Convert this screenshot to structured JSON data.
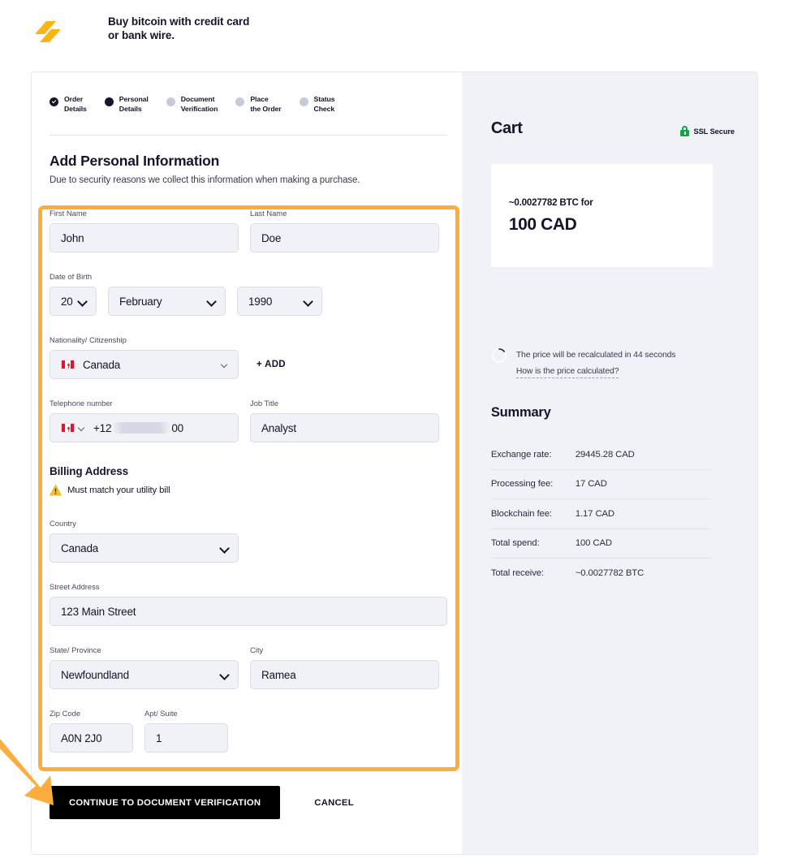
{
  "header": {
    "logo_icon": "lightning-bolt-logo",
    "tagline": "Buy bitcoin with credit card or bank wire."
  },
  "stepper": {
    "steps": [
      {
        "label": "Order\nDetails",
        "state": "done"
      },
      {
        "label": "Personal\nDetails",
        "state": "active"
      },
      {
        "label": "Document\nVerification",
        "state": "pending"
      },
      {
        "label": "Place\nthe Order",
        "state": "pending"
      },
      {
        "label": "Status\nCheck",
        "state": "pending"
      }
    ]
  },
  "form": {
    "title": "Add Personal Information",
    "subtitle": "Due to security reasons we collect this information when making a purchase.",
    "first_name": {
      "label": "First Name",
      "value": "John"
    },
    "last_name": {
      "label": "Last Name",
      "value": "Doe"
    },
    "dob": {
      "label": "Date of Birth",
      "day": "20",
      "month": "February",
      "year": "1990"
    },
    "nationality": {
      "label": "Nationality/ Citizenship",
      "value": "Canada",
      "flag_icon": "canada-flag-icon",
      "add_label": "+ ADD"
    },
    "telephone": {
      "label": "Telephone number",
      "flag_icon": "canada-flag-icon",
      "prefix": "+12",
      "suffix": "00"
    },
    "job_title": {
      "label": "Job Title",
      "value": "Analyst"
    },
    "billing": {
      "heading": "Billing Address",
      "warning_icon": "warning-triangle-icon",
      "warning": "Must match your utility bill"
    },
    "country": {
      "label": "Country",
      "value": "Canada"
    },
    "street": {
      "label": "Street Address",
      "value": "123 Main Street"
    },
    "state": {
      "label": "State/ Province",
      "value": "Newfoundland"
    },
    "city": {
      "label": "City",
      "value": "Ramea"
    },
    "zip": {
      "label": "Zip Code",
      "value": "A0N 2J0"
    },
    "apt": {
      "label": "Apt/ Suite",
      "value": "1"
    }
  },
  "actions": {
    "continue_label": "CONTINUE TO DOCUMENT VERIFICATION",
    "cancel_label": "CANCEL"
  },
  "cart": {
    "title": "Cart",
    "ssl_label": "SSL Secure",
    "ssl_icon": "green-padlock-icon",
    "btc_amount": "~0.0027782 BTC for",
    "fiat_amount": "100 CAD",
    "spinner_icon": "loading-spinner-icon",
    "recalc_text": "The price will be recalculated in 44 seconds",
    "recalc_link": "How is the price calculated?"
  },
  "summary": {
    "title": "Summary",
    "rows": [
      {
        "key": "Exchange rate:",
        "value": "29445.28 CAD"
      },
      {
        "key": "Processing fee:",
        "value": "17 CAD"
      },
      {
        "key": "Blockchain fee:",
        "value": "1.17 CAD"
      },
      {
        "key": "Total spend:",
        "value": "100 CAD"
      },
      {
        "key": "Total receive:",
        "value": "~0.0027782 BTC"
      }
    ]
  },
  "annotation": {
    "highlight_color": "#fbad3e",
    "arrow_icon": "orange-pointer-arrow"
  }
}
